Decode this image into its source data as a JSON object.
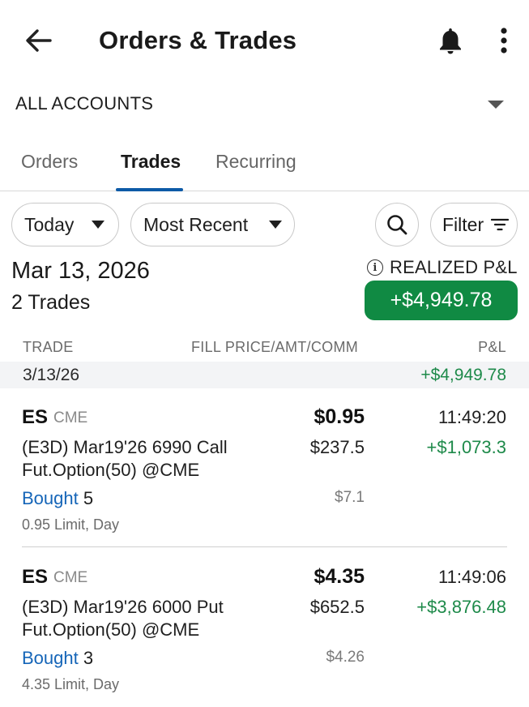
{
  "header": {
    "title": "Orders & Trades",
    "back_icon": "arrow-left-icon",
    "bell_icon": "bell-icon",
    "more_icon": "more-vertical-icon"
  },
  "account": {
    "label": "ALL ACCOUNTS"
  },
  "tabs": [
    {
      "label": "Orders",
      "active": false
    },
    {
      "label": "Trades",
      "active": true
    },
    {
      "label": "Recurring",
      "active": false
    }
  ],
  "filters": {
    "period": "Today",
    "sort": "Most Recent",
    "filter_label": "Filter"
  },
  "summary": {
    "date": "Mar 13, 2026",
    "trade_count": "2 Trades",
    "realized_label": "REALIZED P&L",
    "realized_value": "+$4,949.78"
  },
  "columns": {
    "trade": "TRADE",
    "fill": "FILL PRICE/AMT/COMM",
    "pnl": "P&L"
  },
  "date_group": {
    "date": "3/13/26",
    "pnl": "+$4,949.78"
  },
  "trades": [
    {
      "symbol": "ES",
      "exchange": "CME",
      "price": "$0.95",
      "time": "11:49:20",
      "desc_line1": "(E3D) Mar19'26 6990 Call",
      "desc_line2": "Fut.Option(50) @CME",
      "amount": "$237.5",
      "pnl": "+$1,073.3",
      "side": "Bought",
      "qty": "5",
      "commission": "$7.1",
      "order_info": "0.95 Limit, Day"
    },
    {
      "symbol": "ES",
      "exchange": "CME",
      "price": "$4.35",
      "time": "11:49:06",
      "desc_line1": "(E3D) Mar19'26 6000 Put",
      "desc_line2": "Fut.Option(50) @CME",
      "amount": "$652.5",
      "pnl": "+$3,876.48",
      "side": "Bought",
      "qty": "3",
      "commission": "$4.26",
      "order_info": "4.35 Limit, Day"
    }
  ],
  "colors": {
    "accent_blue": "#0d5aa7",
    "profit_green": "#1e8a4a",
    "pill_green": "#108a43"
  }
}
